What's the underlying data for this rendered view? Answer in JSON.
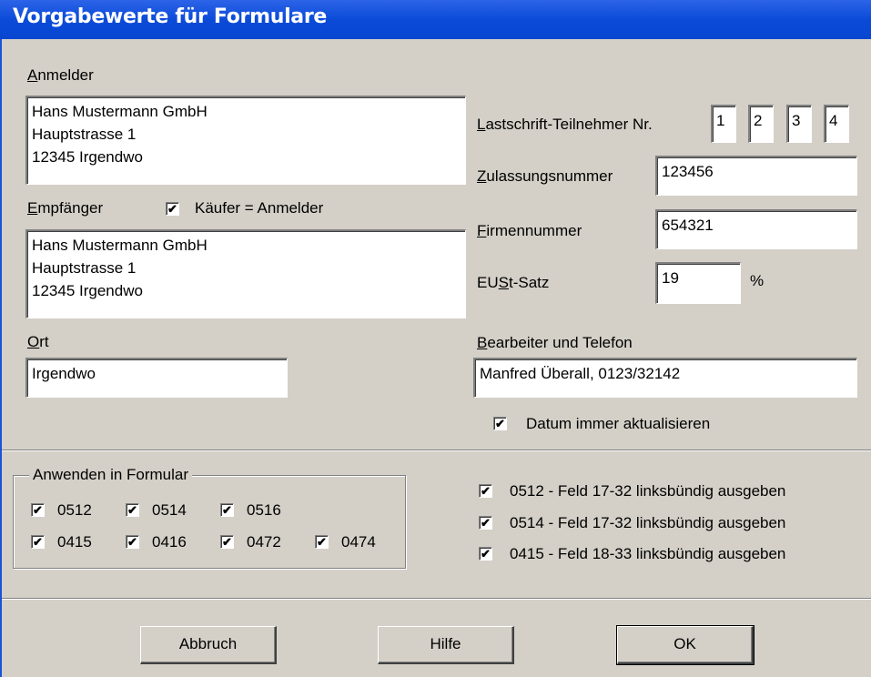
{
  "window": {
    "title": "Vorgabewerte für Formulare"
  },
  "anmelder": {
    "label_ul": "A",
    "label_rest": "nmelder",
    "value": "Hans Mustermann GmbH\nHauptstrasse 1\n12345 Irgendwo"
  },
  "empfaenger": {
    "label_ul": "E",
    "label_rest": "mpfänger",
    "checkbox_label": "Käufer = Anmelder",
    "checked": true,
    "value": "Hans Mustermann GmbH\nHauptstrasse 1\n12345 Irgendwo"
  },
  "ort": {
    "label_ul": "O",
    "label_rest": "rt",
    "value": "Irgendwo"
  },
  "lastschrift": {
    "label_ul": "L",
    "label_rest": "astschrift-Teilnehmer Nr.",
    "digits": [
      "1",
      "2",
      "3",
      "4"
    ]
  },
  "zulassung": {
    "label_ul": "Z",
    "label_rest": "ulassungsnummer",
    "value": "123456"
  },
  "firmennummer": {
    "label_ul": "F",
    "label_rest": "irmennummer",
    "value": "654321"
  },
  "eust": {
    "label_pre": "EU",
    "label_ul": "S",
    "label_rest": "t-Satz",
    "value": "19",
    "unit": "%"
  },
  "bearbeiter": {
    "label_ul": "B",
    "label_rest": "earbeiter und Telefon",
    "value": "Manfred Überall, 0123/32142"
  },
  "datum": {
    "label": "Datum immer aktualisieren",
    "checked": true
  },
  "formulare": {
    "group_title": "Anwenden in Formular",
    "items": [
      {
        "label": "0512",
        "checked": true
      },
      {
        "label": "0514",
        "checked": true
      },
      {
        "label": "0516",
        "checked": true
      },
      {
        "label": "0415",
        "checked": true
      },
      {
        "label": "0416",
        "checked": true
      },
      {
        "label": "0472",
        "checked": true
      },
      {
        "label": "0474",
        "checked": true
      }
    ]
  },
  "options": [
    {
      "label": "0512 - Feld 17-32 linksbündig ausgeben",
      "checked": true
    },
    {
      "label": "0514 - Feld 17-32 linksbündig ausgeben",
      "checked": true
    },
    {
      "label": "0415 - Feld 18-33 linksbündig ausgeben",
      "checked": true
    }
  ],
  "buttons": {
    "cancel": "Abbruch",
    "help": "Hilfe",
    "ok": "OK"
  },
  "check_glyph": "✔"
}
